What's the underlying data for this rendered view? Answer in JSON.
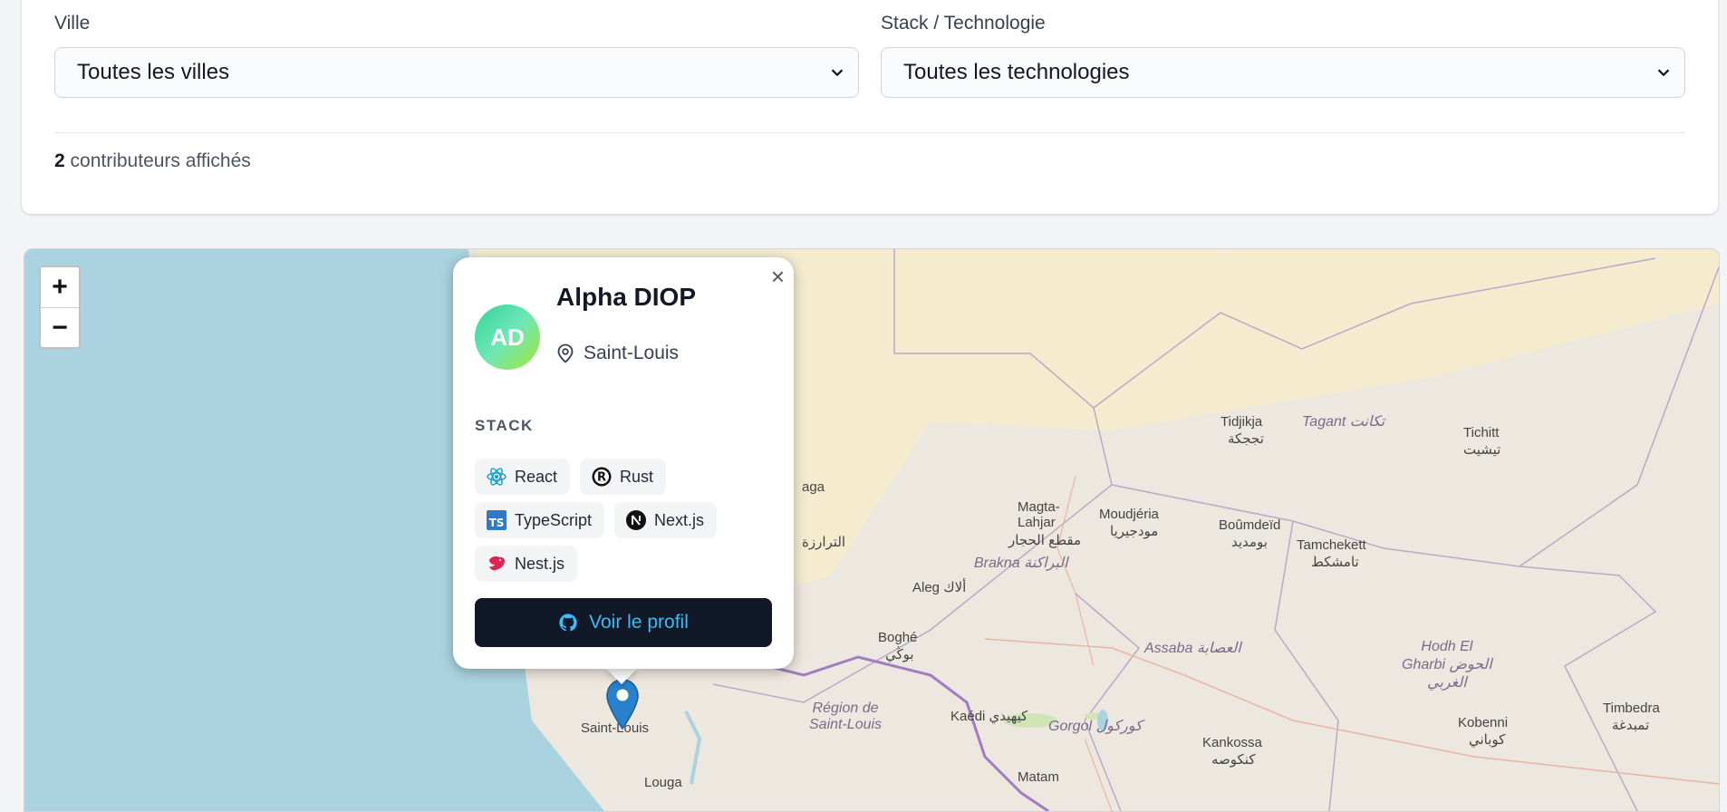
{
  "filters": {
    "city_label": "Ville",
    "city_value": "Toutes les villes",
    "stack_label": "Stack / Technologie",
    "stack_value": "Toutes les technologies"
  },
  "summary": {
    "count": "2",
    "text": "contributeurs affichés"
  },
  "map": {
    "zoom_in": "+",
    "zoom_out": "−",
    "labels": {
      "tidjikja": "Tidjikja",
      "tidjikja_ar": "تججكة",
      "tagant": "Tagant تكانت",
      "tichitt": "Tichitt",
      "tichitt_ar": "تيشيت",
      "magta_lahjar": "Magta-\nLahjar",
      "magta_ar": "مقطع الحجار",
      "moudjeria": "Moudjéria",
      "moudjeria_ar": "مودجيريا",
      "boumdeid": "Boûmdeïd",
      "boumdeid_ar": "بومديد",
      "tamchekett": "Tamchekett",
      "tamchekett_ar": "تامشكط",
      "brakna": "Brakna البراكنة",
      "aleg": "Aleg ألاك",
      "boghe": "Boghé",
      "boghe_ar": "بوڭي",
      "assaba": "Assaba العصابة",
      "hodh": "Hodh El\nGharbi الحوض\nالغربي",
      "region_stl": "Région de\nSaint-Louis",
      "kaedi": "Kaédi كيهيدي",
      "gorgol": "Gorgol كوركول",
      "kankossa": "Kankossa",
      "kankossa_ar": "كنكوصه",
      "kobenni": "Kobenni",
      "kobenni_ar": "كوباني",
      "timbedra": "Timbedra",
      "timbedra_ar": "تمبدغة",
      "matam": "Matam",
      "louga": "Louga",
      "saint_louis": "Saint-Louis",
      "trarza": "الترارزة",
      "aga": "aga"
    }
  },
  "popup": {
    "close": "×",
    "initials": "AD",
    "name": "Alpha DIOP",
    "city": "Saint-Louis",
    "stack_title": "STACK",
    "tags": [
      {
        "label": "React",
        "icon": "react-icon"
      },
      {
        "label": "Rust",
        "icon": "rust-icon"
      },
      {
        "label": "TypeScript",
        "icon": "typescript-icon"
      },
      {
        "label": "Next.js",
        "icon": "nextjs-icon"
      },
      {
        "label": "Nest.js",
        "icon": "nestjs-icon"
      }
    ],
    "button": "Voir le profil"
  },
  "colors": {
    "ocean": "#aad3df",
    "land": "#ede8df",
    "desert": "#f5ecd0",
    "button_bg": "#111827",
    "button_text": "#38bdf8",
    "marker": "#2a81cb"
  }
}
